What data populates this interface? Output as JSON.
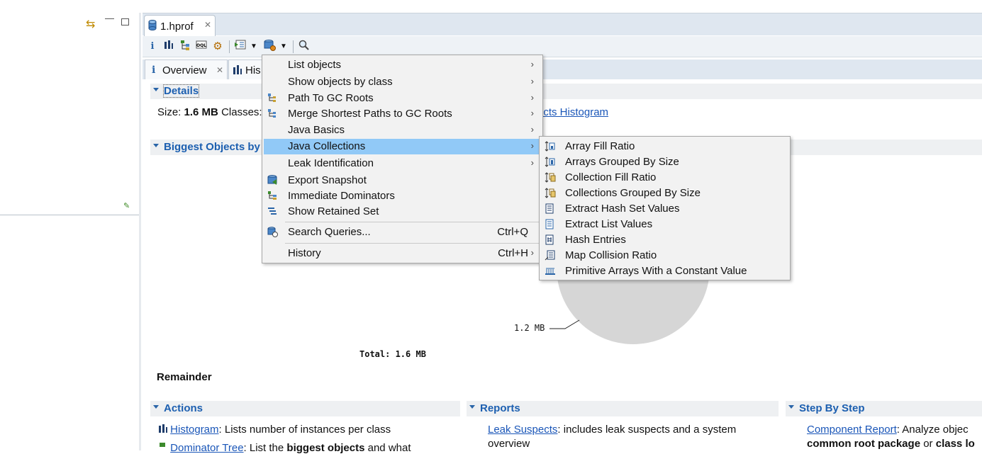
{
  "left_panel": {
    "icons": {
      "sync": "sync-arrows-icon",
      "pin": "pin-icon"
    }
  },
  "editor": {
    "tab": {
      "label": "1.hprof",
      "icon": "heap-dump-icon"
    },
    "toolbar": [
      "info-icon",
      "histogram-icon",
      "dominator-tree-icon",
      "oql-icon",
      "query-browser-icon",
      "report-icon",
      "dropdown-icon",
      "queries-icon",
      "dropdown-icon",
      "search-icon"
    ],
    "subtabs": [
      {
        "label": "Overview",
        "closable": true
      },
      {
        "label": "His",
        "closable": false
      }
    ],
    "details": {
      "title": "Details",
      "size_label": "Size:",
      "size_value": "1.6 MB",
      "classes_label": "Classes:",
      "suspects_link": "ects Histogram"
    },
    "biggest": {
      "title": "Biggest Objects by",
      "slice_label": "1.2 MB",
      "total": "Total: 1.6 MB",
      "remainder": "Remainder"
    },
    "actions": {
      "title": "Actions",
      "item1_link": "Histogram",
      "item1_text": ": Lists number of instances per class",
      "item2_link": "Dominator Tree",
      "item2_text": ": List the ",
      "item2_bold": "biggest objects",
      "item2_tail": " and what"
    },
    "reports": {
      "title": "Reports",
      "item1_link": "Leak Suspects",
      "item1_text": ": includes leak suspects and a system",
      "item1_cont": "overview"
    },
    "stepbystep": {
      "title": "Step By Step",
      "item1_link": "Component Report",
      "item1_text": ": Analyze objec",
      "item1_bold1": "common root package",
      "item1_mid": " or ",
      "item1_bold2": "class lo"
    }
  },
  "menu": {
    "items": [
      {
        "label": "List objects",
        "icon": "",
        "submenu": true
      },
      {
        "label": "Show objects by class",
        "icon": "",
        "submenu": true
      },
      {
        "label": "Path To GC Roots",
        "icon": "path-to-gc-icon",
        "submenu": true
      },
      {
        "label": "Merge Shortest Paths to GC Roots",
        "icon": "merge-paths-icon",
        "submenu": true
      },
      {
        "label": "Java Basics",
        "icon": "",
        "submenu": true
      },
      {
        "label": "Java Collections",
        "icon": "",
        "submenu": true,
        "selected": true
      },
      {
        "label": "Leak Identification",
        "icon": "",
        "submenu": true
      },
      {
        "label": "Export Snapshot",
        "icon": "export-snapshot-icon",
        "submenu": false
      },
      {
        "label": "Immediate Dominators",
        "icon": "dominators-icon",
        "submenu": false
      },
      {
        "label": "Show Retained Set",
        "icon": "retained-set-icon",
        "submenu": false
      },
      {
        "label": "Search Queries...",
        "icon": "search-queries-icon",
        "accel": "Ctrl+Q"
      },
      {
        "label": "History",
        "icon": "",
        "accel": "Ctrl+H",
        "submenu": true
      }
    ]
  },
  "submenu": {
    "items": [
      {
        "label": "Array Fill Ratio",
        "icon": "array-fill-icon"
      },
      {
        "label": "Arrays Grouped By Size",
        "icon": "array-group-icon"
      },
      {
        "label": "Collection Fill Ratio",
        "icon": "collection-fill-icon"
      },
      {
        "label": "Collections Grouped By Size",
        "icon": "collection-group-icon"
      },
      {
        "label": "Extract Hash Set Values",
        "icon": "hashset-icon"
      },
      {
        "label": "Extract List Values",
        "icon": "list-icon"
      },
      {
        "label": "Hash Entries",
        "icon": "hash-entries-icon"
      },
      {
        "label": "Map Collision Ratio",
        "icon": "map-collision-icon"
      },
      {
        "label": "Primitive Arrays With a Constant Value",
        "icon": "primitive-array-icon"
      }
    ]
  },
  "colors": {
    "selection": "#91c9f7",
    "link": "#1a56b8",
    "section_title": "#1c5fb0"
  }
}
